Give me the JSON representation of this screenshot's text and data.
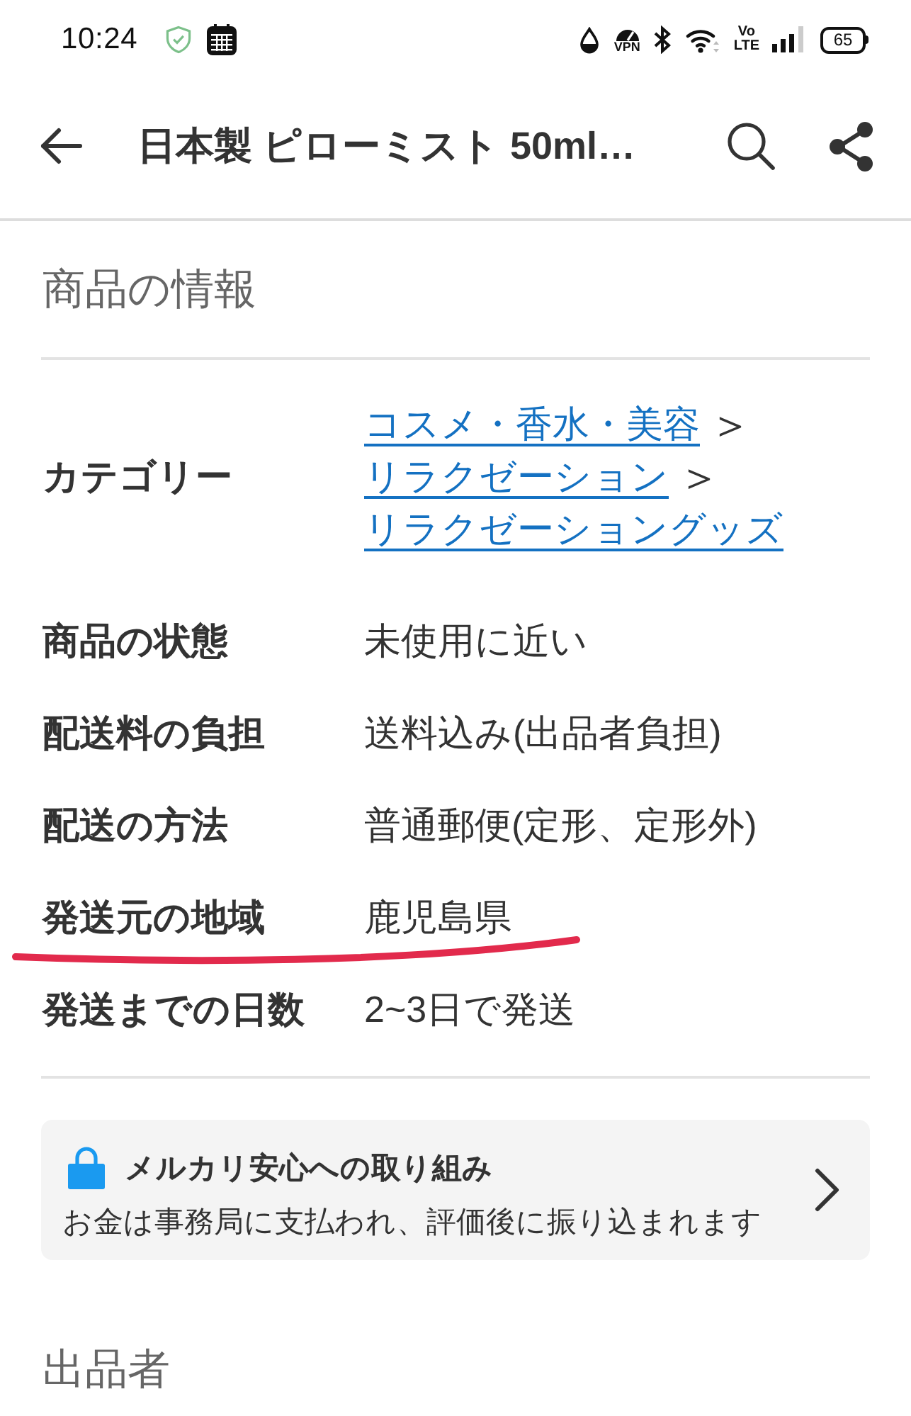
{
  "status_bar": {
    "time": "10:24",
    "vpn": "VPN",
    "volte": [
      "Vo",
      "LTE"
    ],
    "battery": "65"
  },
  "app_bar": {
    "title": "日本製 ピローミスト 50ml…"
  },
  "item_info": {
    "heading": "商品の情報",
    "category": {
      "label": "カテゴリー",
      "path": [
        {
          "label": "コスメ・香水・美容",
          "separator": "＞"
        },
        {
          "label": "リラクゼーション",
          "separator": "＞"
        },
        {
          "label": "リラクゼーショングッズ"
        }
      ]
    },
    "rows": [
      {
        "label": "商品の状態",
        "value": "未使用に近い",
        "underlined": false
      },
      {
        "label": "配送料の負担",
        "value": "送料込み(出品者負担)",
        "underlined": false
      },
      {
        "label": "配送の方法",
        "value": "普通郵便(定形、定形外)",
        "underlined": false
      },
      {
        "label": "発送元の地域",
        "value": "鹿児島県",
        "underlined": true
      },
      {
        "label": "発送までの日数",
        "value": "2~3日で発送",
        "underlined": false
      }
    ]
  },
  "safety_notice": {
    "title": "メルカリ安心への取り組み",
    "description": "お金は事務局に支払われ、評価後に振り込まれます"
  },
  "seller": {
    "heading": "出品者"
  }
}
